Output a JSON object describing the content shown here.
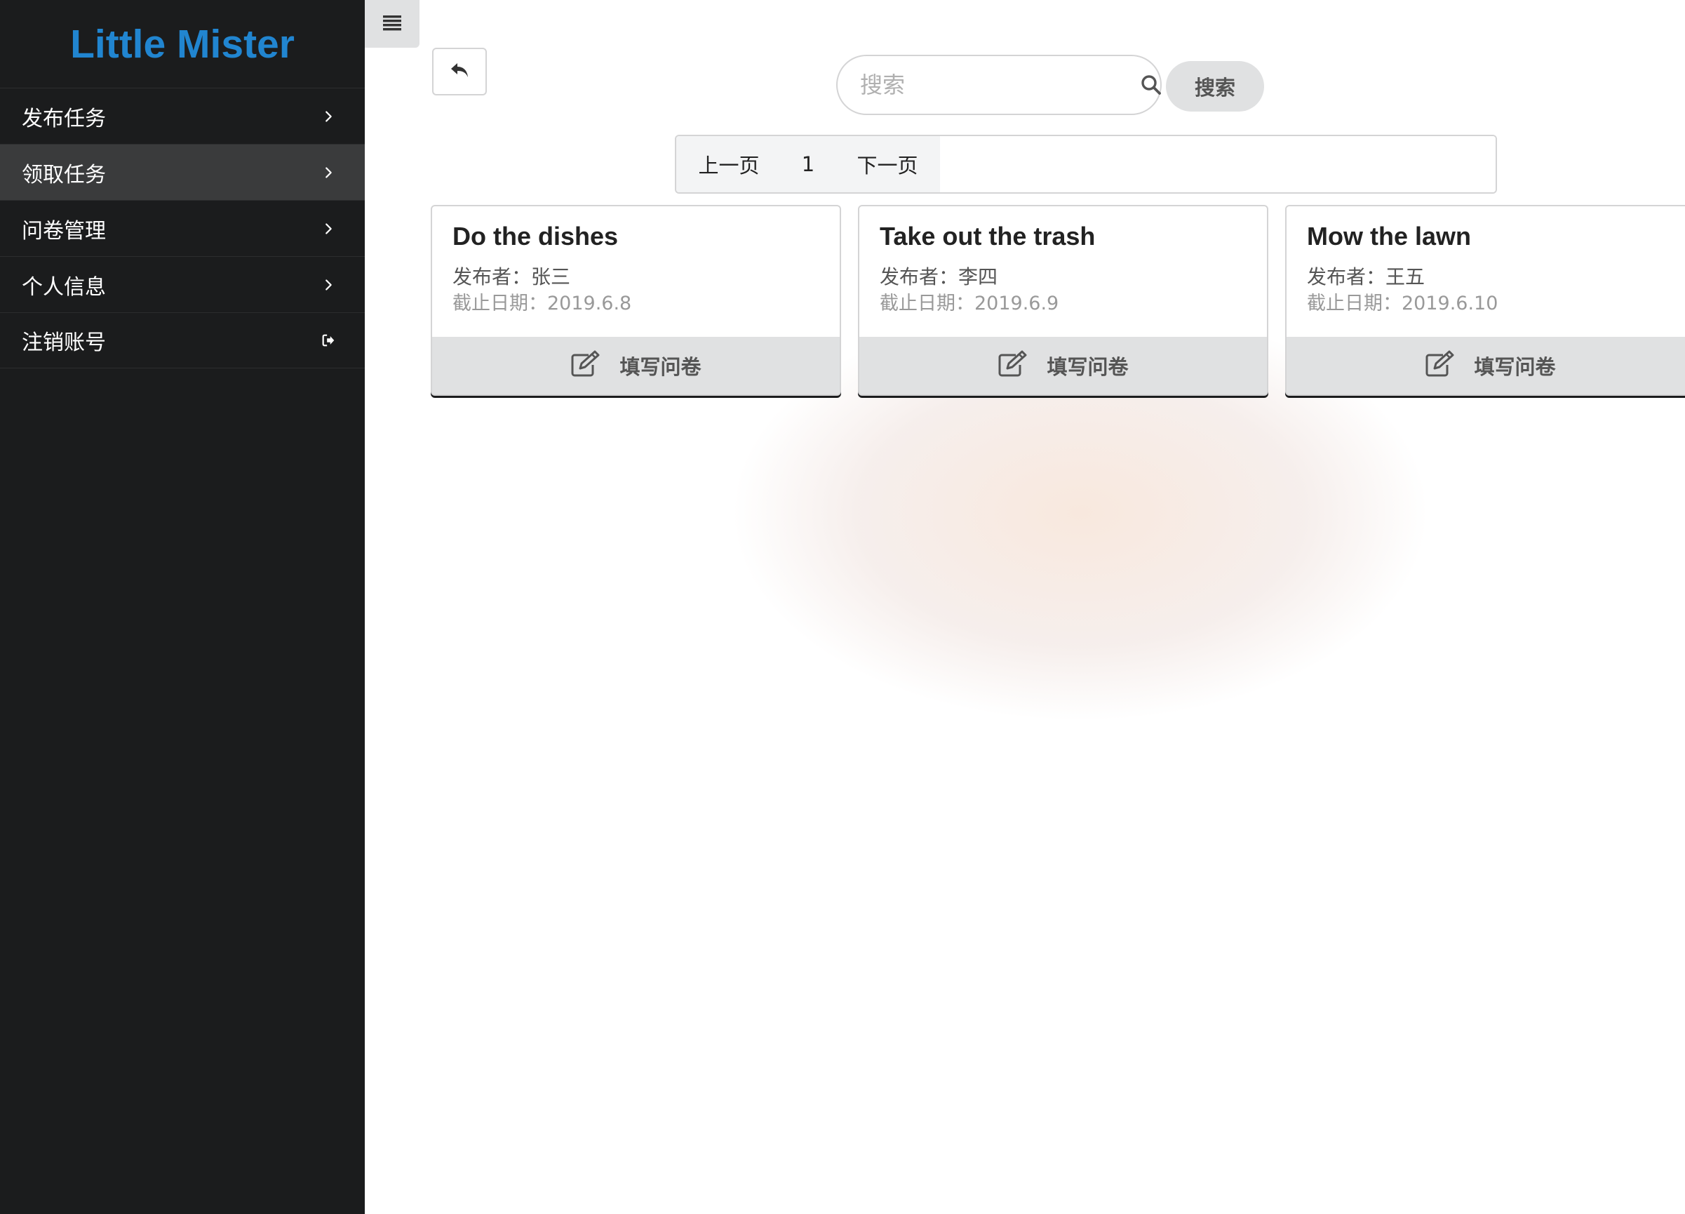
{
  "app": {
    "brand": "Little Mister"
  },
  "sidebar": {
    "items": [
      {
        "label": "发布任务",
        "icon": "chevron-right-icon",
        "active": false
      },
      {
        "label": "领取任务",
        "icon": "chevron-right-icon",
        "active": true
      },
      {
        "label": "问卷管理",
        "icon": "chevron-right-icon",
        "active": false
      },
      {
        "label": "个人信息",
        "icon": "chevron-right-icon",
        "active": false
      },
      {
        "label": "注销账号",
        "icon": "sign-out-icon",
        "active": false
      }
    ]
  },
  "toolbar": {
    "menu_icon": "hamburger-icon",
    "back_icon": "reply-icon"
  },
  "search": {
    "placeholder": "搜索",
    "value": "",
    "icon": "search-icon",
    "button_label": "搜索"
  },
  "pagination": {
    "prev": "上一页",
    "current": "1",
    "next": "下一页"
  },
  "tasks": [
    {
      "title": "Do the dishes",
      "publisher": "发布者：张三",
      "deadline": "截止日期：2019.6.8",
      "action": "填写问卷"
    },
    {
      "title": "Take out the trash",
      "publisher": "发布者：李四",
      "deadline": "截止日期：2019.6.9",
      "action": "填写问卷"
    },
    {
      "title": "Mow the lawn",
      "publisher": "发布者：王五",
      "deadline": "截止日期：2019.6.10",
      "action": "填写问卷"
    }
  ],
  "colors": {
    "sidebar_bg": "#1b1c1d",
    "brand": "#2185d0",
    "active_item": "#3a3b3c",
    "button_grey": "#e0e1e2"
  }
}
